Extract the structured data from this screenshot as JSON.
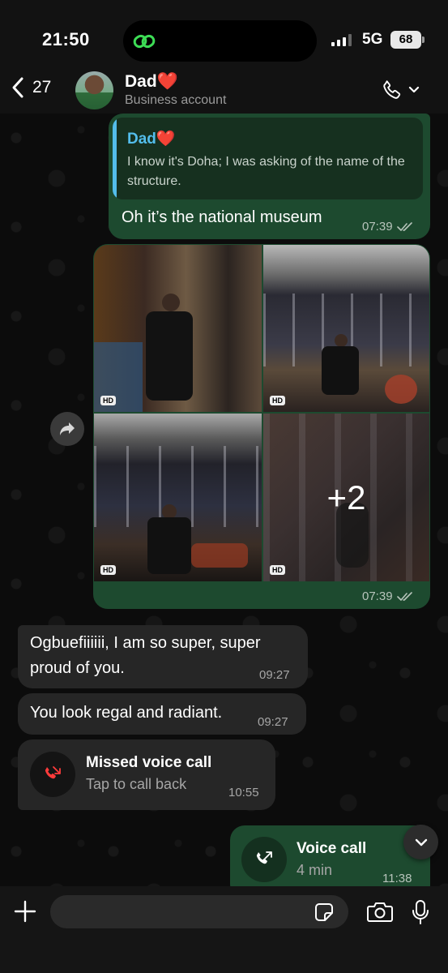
{
  "status_bar": {
    "time": "21:50",
    "network": "5G",
    "battery": "68"
  },
  "header": {
    "back_count": "27",
    "contact_name": "Dad❤️",
    "contact_subtitle": "Business account"
  },
  "messages": {
    "reply": {
      "quoted_name": "Dad❤️",
      "quoted_text": "I know it's Doha; I was asking of the name of the structure.",
      "text": "Oh it’s the national museum",
      "time": "07:39"
    },
    "album": {
      "more_count": "+2",
      "time": "07:39",
      "hd_label": "HD"
    },
    "incoming_1": {
      "text": "Ogbuefiiiiii, I am so super, super proud of you.",
      "time": "09:27"
    },
    "incoming_2": {
      "text": "You look regal and radiant.",
      "time": "09:27"
    },
    "missed_call": {
      "title": "Missed voice call",
      "subtitle": "Tap to call back",
      "time": "10:55"
    },
    "voice_call": {
      "title": "Voice call",
      "subtitle": "4 min",
      "time": "11:38"
    }
  },
  "composer": {
    "placeholder": ""
  },
  "colors": {
    "outgoing_bubble": "#1d4a2f",
    "incoming_bubble": "#262626",
    "quote_accent": "#53bdeb",
    "missed_call_red": "#ff3b3b"
  }
}
